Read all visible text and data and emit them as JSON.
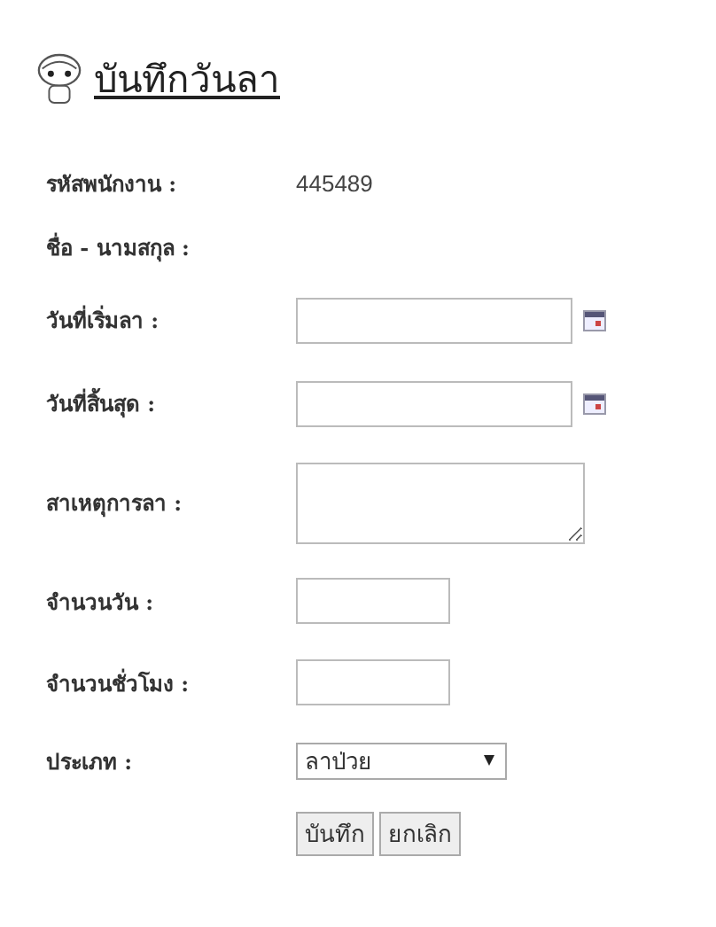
{
  "title": "บันทึกวันลา",
  "fields": [
    {
      "kind": "text",
      "label": "รหัสพนักงาน :",
      "value": "445489"
    },
    {
      "kind": "text",
      "label": "ชื่อ - นามสกุล :"
    },
    {
      "kind": "date",
      "label": "วันที่เริ่มลา :"
    },
    {
      "kind": "date",
      "label": "วันที่สิ้นสุด :"
    },
    {
      "kind": "textarea",
      "label": "สาเหตุการลา :"
    },
    {
      "kind": "input",
      "label": "จำนวนวัน :"
    },
    {
      "kind": "input",
      "label": "จำนวนชั่วโมง :"
    },
    {
      "kind": "select",
      "label": "ประเภท :",
      "value": "ลาป่วย"
    }
  ],
  "buttons": [
    "บันทึก",
    "ยกเลิก"
  ]
}
